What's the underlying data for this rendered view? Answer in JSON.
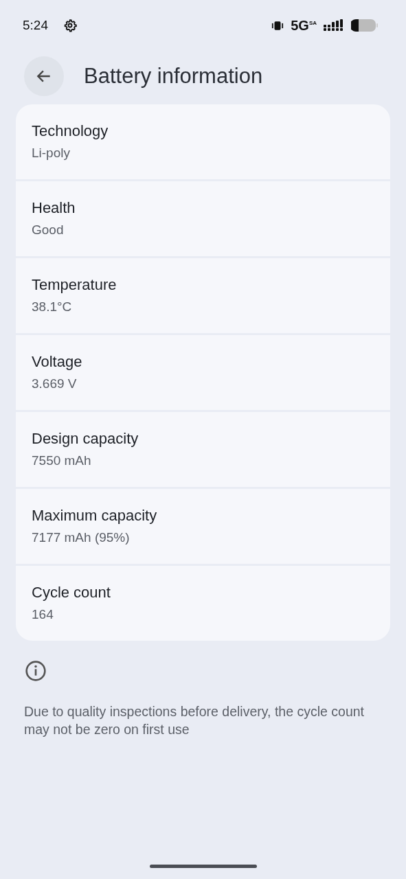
{
  "status_bar": {
    "time": "5:24",
    "network": "5G$^{SA}$"
  },
  "header": {
    "title": "Battery information"
  },
  "items": [
    {
      "title": "Technology",
      "value": "Li-poly"
    },
    {
      "title": "Health",
      "value": "Good"
    },
    {
      "title": "Temperature",
      "value": "38.1°C"
    },
    {
      "title": "Voltage",
      "value": "3.669 V"
    },
    {
      "title": "Design capacity",
      "value": "7550 mAh"
    },
    {
      "title": "Maximum capacity",
      "value": "7177 mAh (95%)"
    },
    {
      "title": "Cycle count",
      "value": "164"
    }
  ],
  "note": "Due to quality inspections before delivery, the cycle count may not be zero on first use"
}
